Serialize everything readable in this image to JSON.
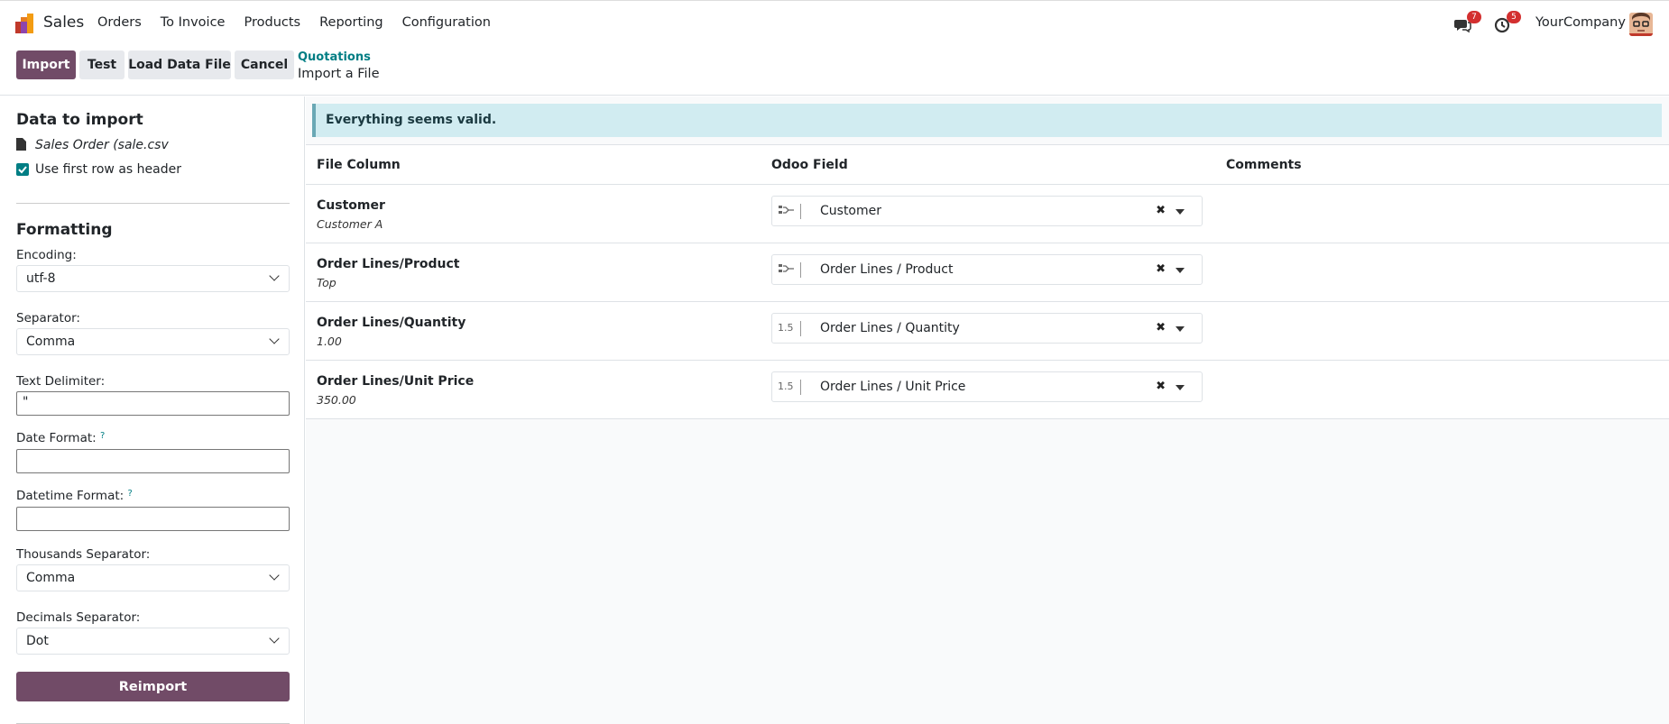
{
  "topbar": {
    "app_name": "Sales",
    "menu": [
      "Orders",
      "To Invoice",
      "Products",
      "Reporting",
      "Configuration"
    ],
    "messages_count": "7",
    "activities_count": "5",
    "company": "YourCompany"
  },
  "control_panel": {
    "import_label": "Import",
    "test_label": "Test",
    "load_label": "Load Data File",
    "cancel_label": "Cancel",
    "breadcrumb_parent": "Quotations",
    "breadcrumb_current": "Import a File"
  },
  "sidebar": {
    "data_heading": "Data to import",
    "file_name": "Sales Order (sale.csv",
    "header_checkbox_label": "Use first row as header",
    "header_checked": true,
    "formatting_heading": "Formatting",
    "encoding_label": "Encoding:",
    "encoding_value": "utf-8",
    "separator_label": "Separator:",
    "separator_value": "Comma",
    "delimiter_label": "Text Delimiter:",
    "delimiter_value": "\"",
    "date_format_label": "Date Format:",
    "date_format_value": "",
    "datetime_format_label": "Datetime Format:",
    "datetime_format_value": "",
    "help_mark": "?",
    "thousands_label": "Thousands Separator:",
    "thousands_value": "Comma",
    "decimals_label": "Decimals Separator:",
    "decimals_value": "Dot",
    "reimport_label": "Reimport"
  },
  "main": {
    "alert": "Everything seems valid.",
    "headers": {
      "file_column": "File Column",
      "odoo_field": "Odoo Field",
      "comments": "Comments"
    },
    "rows": [
      {
        "name": "Customer",
        "sample": "Customer A",
        "field_icon": "relation-icon",
        "field": "Customer"
      },
      {
        "name": "Order Lines/Product",
        "sample": "Top",
        "field_icon": "relation-icon",
        "field": "Order Lines / Product"
      },
      {
        "name": "Order Lines/Quantity",
        "sample": "1.00",
        "field_icon": "1.5",
        "field": "Order Lines / Quantity"
      },
      {
        "name": "Order Lines/Unit Price",
        "sample": "350.00",
        "field_icon": "1.5",
        "field": "Order Lines / Unit Price"
      }
    ]
  },
  "colors": {
    "brand": "#714b67",
    "alert_bg": "#d1ecf1",
    "link": "#017e84"
  }
}
